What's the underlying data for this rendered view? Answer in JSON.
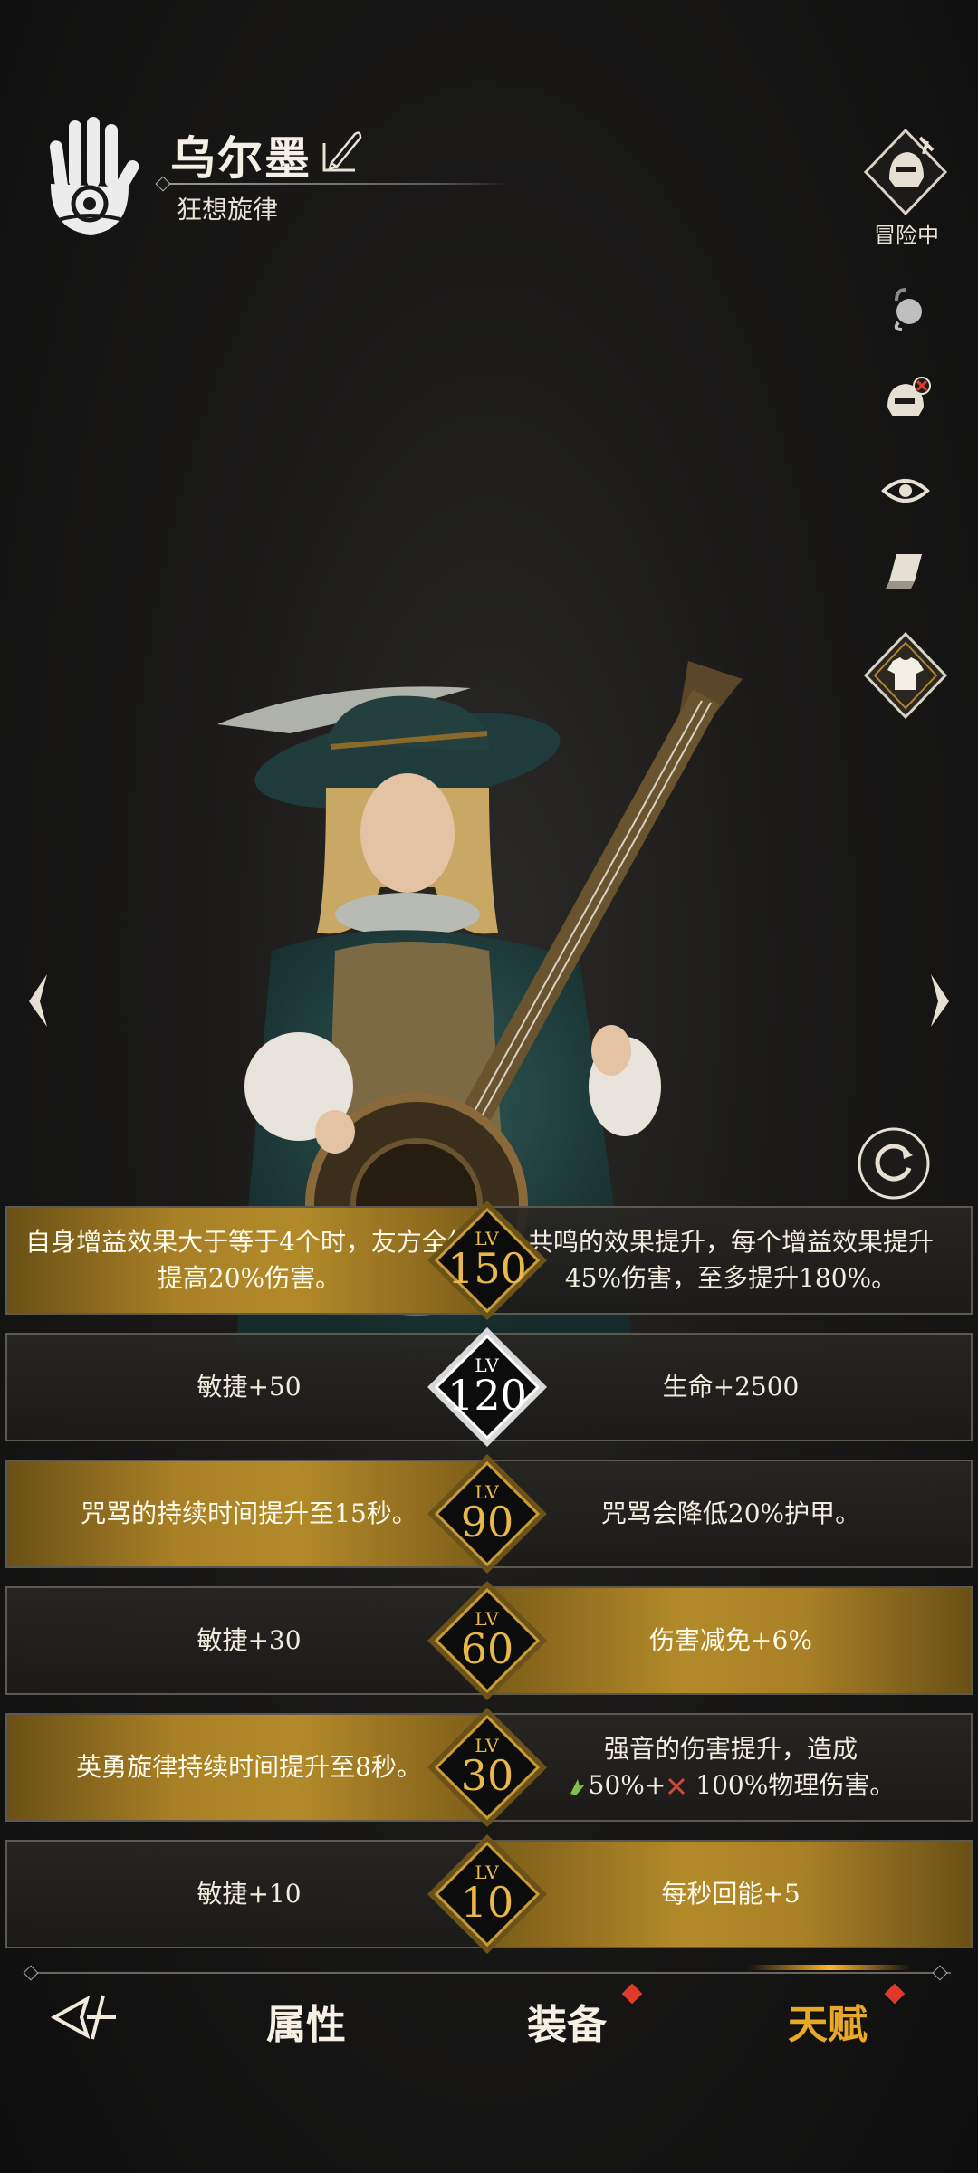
{
  "header": {
    "name": "乌尔墨",
    "title": "狂想旋律"
  },
  "toolbar": {
    "adventure_label": "冒险中"
  },
  "talents": [
    {
      "level_prefix": "LV",
      "level": "150",
      "left": "自身增益效果大于等于4个时，友方全体提高20%伤害。",
      "right": "共鸣的效果提升，每个增益效果提升45%伤害，至多提升180%。"
    },
    {
      "level_prefix": "LV",
      "level": "120",
      "left": "敏捷+50",
      "right": "生命+2500"
    },
    {
      "level_prefix": "LV",
      "level": "90",
      "left": "咒骂的持续时间提升至15秒。",
      "right": "咒骂会降低20%护甲。"
    },
    {
      "level_prefix": "LV",
      "level": "60",
      "left": "敏捷+30",
      "right": "伤害减免+6%"
    },
    {
      "level_prefix": "LV",
      "level": "30",
      "left": "英勇旋律持续时间提升至8秒。",
      "right_line1": "强音的伤害提升，造成",
      "right_line2_a": "50%+",
      "right_line2_b": "100%物理伤害。"
    },
    {
      "level_prefix": "LV",
      "level": "10",
      "left": "敏捷+10",
      "right": "每秒回能+5"
    }
  ],
  "nav": {
    "attributes": "属性",
    "equipment": "装备",
    "talent": "天赋"
  },
  "colors": {
    "gold": "#b08628",
    "accent_orange": "#e8a828",
    "badge_text": "#e8b94a",
    "notify_red": "#e03a2a"
  }
}
